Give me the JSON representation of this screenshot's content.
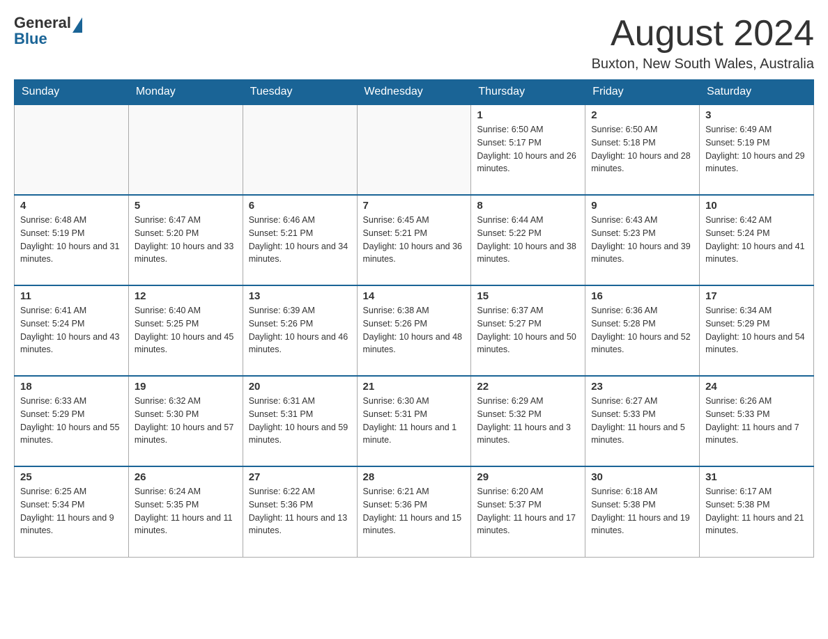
{
  "header": {
    "logo_general": "General",
    "logo_blue": "Blue",
    "month_year": "August 2024",
    "location": "Buxton, New South Wales, Australia"
  },
  "days_of_week": [
    "Sunday",
    "Monday",
    "Tuesday",
    "Wednesday",
    "Thursday",
    "Friday",
    "Saturday"
  ],
  "weeks": [
    [
      {
        "day": "",
        "info": ""
      },
      {
        "day": "",
        "info": ""
      },
      {
        "day": "",
        "info": ""
      },
      {
        "day": "",
        "info": ""
      },
      {
        "day": "1",
        "info": "Sunrise: 6:50 AM\nSunset: 5:17 PM\nDaylight: 10 hours and 26 minutes."
      },
      {
        "day": "2",
        "info": "Sunrise: 6:50 AM\nSunset: 5:18 PM\nDaylight: 10 hours and 28 minutes."
      },
      {
        "day": "3",
        "info": "Sunrise: 6:49 AM\nSunset: 5:19 PM\nDaylight: 10 hours and 29 minutes."
      }
    ],
    [
      {
        "day": "4",
        "info": "Sunrise: 6:48 AM\nSunset: 5:19 PM\nDaylight: 10 hours and 31 minutes."
      },
      {
        "day": "5",
        "info": "Sunrise: 6:47 AM\nSunset: 5:20 PM\nDaylight: 10 hours and 33 minutes."
      },
      {
        "day": "6",
        "info": "Sunrise: 6:46 AM\nSunset: 5:21 PM\nDaylight: 10 hours and 34 minutes."
      },
      {
        "day": "7",
        "info": "Sunrise: 6:45 AM\nSunset: 5:21 PM\nDaylight: 10 hours and 36 minutes."
      },
      {
        "day": "8",
        "info": "Sunrise: 6:44 AM\nSunset: 5:22 PM\nDaylight: 10 hours and 38 minutes."
      },
      {
        "day": "9",
        "info": "Sunrise: 6:43 AM\nSunset: 5:23 PM\nDaylight: 10 hours and 39 minutes."
      },
      {
        "day": "10",
        "info": "Sunrise: 6:42 AM\nSunset: 5:24 PM\nDaylight: 10 hours and 41 minutes."
      }
    ],
    [
      {
        "day": "11",
        "info": "Sunrise: 6:41 AM\nSunset: 5:24 PM\nDaylight: 10 hours and 43 minutes."
      },
      {
        "day": "12",
        "info": "Sunrise: 6:40 AM\nSunset: 5:25 PM\nDaylight: 10 hours and 45 minutes."
      },
      {
        "day": "13",
        "info": "Sunrise: 6:39 AM\nSunset: 5:26 PM\nDaylight: 10 hours and 46 minutes."
      },
      {
        "day": "14",
        "info": "Sunrise: 6:38 AM\nSunset: 5:26 PM\nDaylight: 10 hours and 48 minutes."
      },
      {
        "day": "15",
        "info": "Sunrise: 6:37 AM\nSunset: 5:27 PM\nDaylight: 10 hours and 50 minutes."
      },
      {
        "day": "16",
        "info": "Sunrise: 6:36 AM\nSunset: 5:28 PM\nDaylight: 10 hours and 52 minutes."
      },
      {
        "day": "17",
        "info": "Sunrise: 6:34 AM\nSunset: 5:29 PM\nDaylight: 10 hours and 54 minutes."
      }
    ],
    [
      {
        "day": "18",
        "info": "Sunrise: 6:33 AM\nSunset: 5:29 PM\nDaylight: 10 hours and 55 minutes."
      },
      {
        "day": "19",
        "info": "Sunrise: 6:32 AM\nSunset: 5:30 PM\nDaylight: 10 hours and 57 minutes."
      },
      {
        "day": "20",
        "info": "Sunrise: 6:31 AM\nSunset: 5:31 PM\nDaylight: 10 hours and 59 minutes."
      },
      {
        "day": "21",
        "info": "Sunrise: 6:30 AM\nSunset: 5:31 PM\nDaylight: 11 hours and 1 minute."
      },
      {
        "day": "22",
        "info": "Sunrise: 6:29 AM\nSunset: 5:32 PM\nDaylight: 11 hours and 3 minutes."
      },
      {
        "day": "23",
        "info": "Sunrise: 6:27 AM\nSunset: 5:33 PM\nDaylight: 11 hours and 5 minutes."
      },
      {
        "day": "24",
        "info": "Sunrise: 6:26 AM\nSunset: 5:33 PM\nDaylight: 11 hours and 7 minutes."
      }
    ],
    [
      {
        "day": "25",
        "info": "Sunrise: 6:25 AM\nSunset: 5:34 PM\nDaylight: 11 hours and 9 minutes."
      },
      {
        "day": "26",
        "info": "Sunrise: 6:24 AM\nSunset: 5:35 PM\nDaylight: 11 hours and 11 minutes."
      },
      {
        "day": "27",
        "info": "Sunrise: 6:22 AM\nSunset: 5:36 PM\nDaylight: 11 hours and 13 minutes."
      },
      {
        "day": "28",
        "info": "Sunrise: 6:21 AM\nSunset: 5:36 PM\nDaylight: 11 hours and 15 minutes."
      },
      {
        "day": "29",
        "info": "Sunrise: 6:20 AM\nSunset: 5:37 PM\nDaylight: 11 hours and 17 minutes."
      },
      {
        "day": "30",
        "info": "Sunrise: 6:18 AM\nSunset: 5:38 PM\nDaylight: 11 hours and 19 minutes."
      },
      {
        "day": "31",
        "info": "Sunrise: 6:17 AM\nSunset: 5:38 PM\nDaylight: 11 hours and 21 minutes."
      }
    ]
  ]
}
